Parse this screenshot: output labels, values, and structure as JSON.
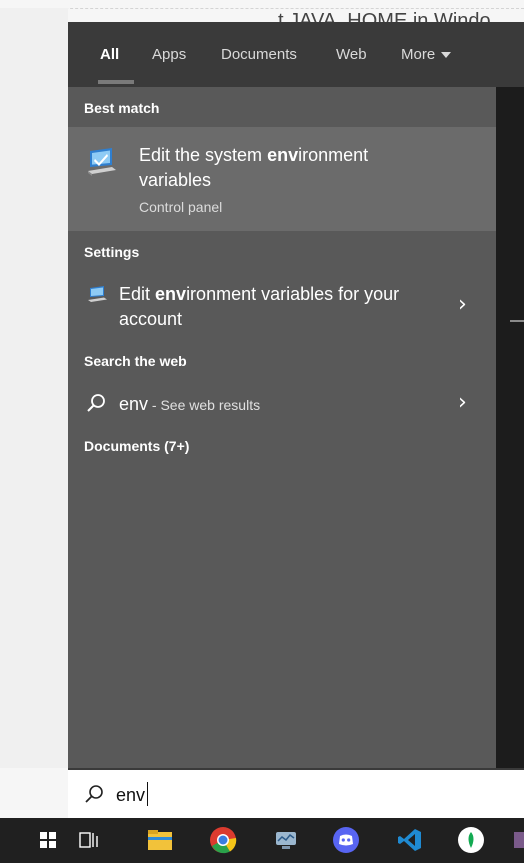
{
  "background_page": {
    "heading_fragment": "t JAVA_HOME in Windo"
  },
  "tabs": [
    {
      "label": "All",
      "active": true
    },
    {
      "label": "Apps",
      "active": false
    },
    {
      "label": "Documents",
      "active": false
    },
    {
      "label": "Web",
      "active": false
    },
    {
      "label": "More",
      "active": false
    }
  ],
  "sections": {
    "best_match": "Best match",
    "settings": "Settings",
    "search_web": "Search the web",
    "documents": "Documents (7+)"
  },
  "best_match": {
    "title_before": "Edit the system ",
    "title_bold": "env",
    "title_after": "ironment variables",
    "subtitle": "Control panel",
    "icon": "computer-settings-icon"
  },
  "settings_result": {
    "text_before": "Edit ",
    "text_bold": "env",
    "text_after": "ironment variables for your account",
    "icon": "computer-settings-icon"
  },
  "web_result": {
    "query": "env",
    "suffix": " - See web results",
    "icon": "search-icon"
  },
  "search": {
    "value": "env",
    "icon": "search-icon"
  },
  "taskbar": [
    {
      "name": "start",
      "icon": "windows-logo-icon"
    },
    {
      "name": "task-view",
      "icon": "task-view-icon"
    },
    {
      "name": "file-explorer",
      "icon": "folder-icon"
    },
    {
      "name": "chrome",
      "icon": "chrome-icon"
    },
    {
      "name": "network-app",
      "icon": "network-monitor-icon"
    },
    {
      "name": "discord",
      "icon": "discord-icon"
    },
    {
      "name": "vscode",
      "icon": "vscode-icon"
    },
    {
      "name": "mongodb-compass",
      "icon": "mongodb-leaf-icon"
    }
  ],
  "colors": {
    "panel_dark": "#3a3a3a",
    "results_bg": "#595959",
    "best_match_bg": "#6b6b6b",
    "taskbar": "#202020",
    "accent_blue": "#3c8fd9"
  }
}
